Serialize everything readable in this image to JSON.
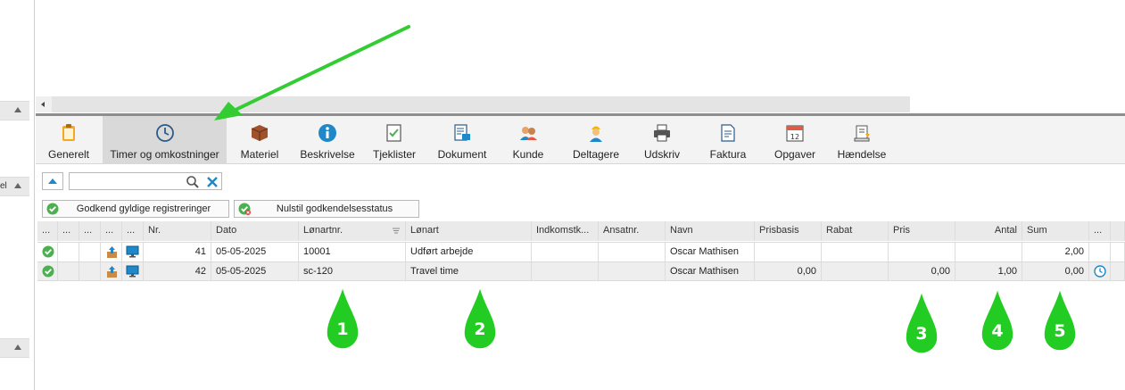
{
  "left_panel": {
    "fragment": "el"
  },
  "toolbar": {
    "items": [
      {
        "label": "Generelt",
        "icon": "clipboard-icon"
      },
      {
        "label": "Timer og omkostninger",
        "icon": "clock-icon"
      },
      {
        "label": "Materiel",
        "icon": "box-icon"
      },
      {
        "label": "Beskrivelse",
        "icon": "info-icon"
      },
      {
        "label": "Tjeklister",
        "icon": "checklist-icon"
      },
      {
        "label": "Dokument",
        "icon": "document-icon"
      },
      {
        "label": "Kunde",
        "icon": "customers-icon"
      },
      {
        "label": "Deltagere",
        "icon": "worker-icon"
      },
      {
        "label": "Udskriv",
        "icon": "printer-icon"
      },
      {
        "label": "Faktura",
        "icon": "invoice-icon"
      },
      {
        "label": "Opgaver",
        "icon": "calendar-icon"
      },
      {
        "label": "Hændelse",
        "icon": "scroll-icon"
      }
    ],
    "active_index": 1
  },
  "search": {
    "value": "",
    "placeholder": ""
  },
  "actions": {
    "approve_label": "Godkend gyldige registreringer",
    "reset_label": "Nulstil godkendelsesstatus"
  },
  "grid": {
    "columns": [
      "...",
      "...",
      "...",
      "...",
      "...",
      "Nr.",
      "Dato",
      "Lønartnr.",
      "Lønart",
      "Indkomstk...",
      "Ansatnr.",
      "Navn",
      "Prisbasis",
      "Rabat",
      "Pris",
      "Antal",
      "Sum",
      "...",
      ""
    ],
    "rows": [
      {
        "nr": "41",
        "dato": "05-05-2025",
        "lonartnr": "10001",
        "lonart": "Udført arbejde",
        "indkomst": "",
        "ansatnr": "",
        "navn": "Oscar Mathisen",
        "prisbasis": "",
        "rabat": "",
        "pris": "",
        "antal": "",
        "sum": "2,00",
        "has_clock": false
      },
      {
        "nr": "42",
        "dato": "05-05-2025",
        "lonartnr": "sc-120",
        "lonart": "Travel time",
        "indkomst": "",
        "ansatnr": "",
        "navn": "Oscar Mathisen",
        "prisbasis": "0,00",
        "rabat": "",
        "pris": "0,00",
        "antal": "1,00",
        "sum": "0,00",
        "has_clock": true
      }
    ]
  },
  "annotations": {
    "markers": [
      "1",
      "2",
      "3",
      "4",
      "5"
    ],
    "color": "#22cc22"
  },
  "colors": {
    "accent_blue": "#1e88c8",
    "check_green": "#4caf50",
    "active_tab_bg": "#d9d9d9",
    "marker_green": "#22cc22"
  }
}
